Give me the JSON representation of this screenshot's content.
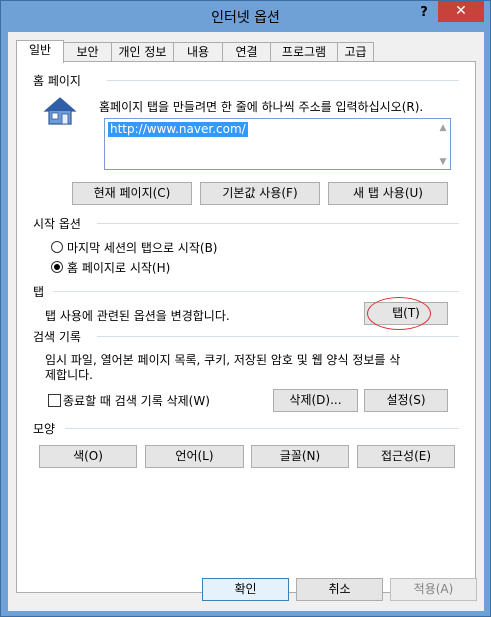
{
  "window": {
    "title": "인터넷 옵션",
    "help": "?",
    "close": "✕"
  },
  "tabs": [
    {
      "label": "일반",
      "active": true
    },
    {
      "label": "보안"
    },
    {
      "label": "개인 정보"
    },
    {
      "label": "내용"
    },
    {
      "label": "연결"
    },
    {
      "label": "프로그램"
    },
    {
      "label": "고급"
    }
  ],
  "home": {
    "section": "홈 페이지",
    "instruction": "홈페이지 탭을 만들려면 한 줄에 하나씩 주소를 입력하십시오(R).",
    "url": "http://www.naver.com/",
    "icon": "house-icon",
    "buttons": {
      "current": "현재 페이지(C)",
      "default": "기본값 사용(F)",
      "newtab": "새 탭 사용(U)"
    }
  },
  "startup": {
    "section": "시작 옵션",
    "options": [
      {
        "label": "마지막 세션의 탭으로 시작(B)",
        "checked": false
      },
      {
        "label": "홈 페이지로 시작(H)",
        "checked": true
      }
    ]
  },
  "tabs_section": {
    "section": "탭",
    "description": "탭 사용에 관련된 옵션을 변경합니다.",
    "button": "탭(T)"
  },
  "history": {
    "section": "검색 기록",
    "description_line1": "임시 파일, 열어본 페이지 목록, 쿠키, 저장된 암호 및 웹 양식 정보를 삭",
    "description_line2": "제합니다.",
    "checkbox": "종료할 때 검색 기록 삭제(W)",
    "delete": "삭제(D)...",
    "settings": "설정(S)"
  },
  "appearance": {
    "section": "모양",
    "colors": "색(O)",
    "languages": "언어(L)",
    "fonts": "글꼴(N)",
    "accessibility": "접근성(E)"
  },
  "footer": {
    "ok": "확인",
    "cancel": "취소",
    "apply": "적용(A)"
  },
  "colors": {
    "title_bar": "#6fa0d6",
    "close_button": "#c7423b",
    "selection": "#3399ff",
    "annotation": "#e03030"
  }
}
